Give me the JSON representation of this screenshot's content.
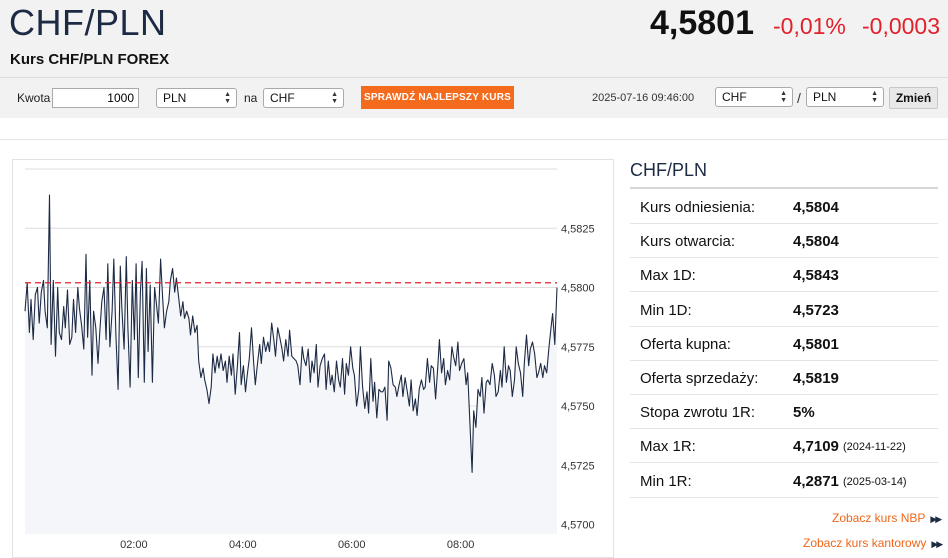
{
  "header": {
    "pair": "CHF/PLN",
    "subtitle": "Kurs CHF/PLN FOREX",
    "price": "4,5801",
    "change_pct": "-0,01%",
    "change_abs": "-0,0003",
    "colors": {
      "negative": "#e2202c",
      "title": "#1d2a44",
      "accent": "#f56b1e"
    }
  },
  "converter": {
    "amount_label": "Kwota",
    "amount_value": "1000",
    "from_currency": "PLN",
    "to_label": "na",
    "to_currency": "CHF",
    "best_rate_button": "SPRAWDŹ NAJLEPSZY KURS"
  },
  "pair_picker": {
    "datetime": "2025-07-16 09:46:00",
    "base": "CHF",
    "separator": "/",
    "quote": "PLN",
    "change_button": "Zmień"
  },
  "stats": {
    "title": "CHF/PLN",
    "rows": [
      {
        "label": "Kurs odniesienia:",
        "value": "4,5804",
        "date": ""
      },
      {
        "label": "Kurs otwarcia:",
        "value": "4,5804",
        "date": ""
      },
      {
        "label": "Max 1D:",
        "value": "4,5843",
        "date": ""
      },
      {
        "label": "Min 1D:",
        "value": "4,5723",
        "date": ""
      },
      {
        "label": "Oferta kupna:",
        "value": "4,5801",
        "date": ""
      },
      {
        "label": "Oferta sprzedaży:",
        "value": "4,5819",
        "date": ""
      },
      {
        "label": "Stopa zwrotu 1R:",
        "value": "5%",
        "date": ""
      },
      {
        "label": "Max 1R:",
        "value": "4,7109",
        "date": "(2024-11-22)"
      },
      {
        "label": "Min 1R:",
        "value": "4,2871",
        "date": "(2025-03-14)"
      }
    ]
  },
  "links": {
    "nbp": "Zobacz kurs NBP",
    "kantor": "Zobacz kurs kantorowy",
    "chevron": "▶▶"
  },
  "chart_data": {
    "type": "line",
    "title": "",
    "xlabel": "",
    "ylabel": "",
    "x_tick_labels": [
      "02:00",
      "04:00",
      "06:00",
      "08:00"
    ],
    "x_tick_hours": [
      2,
      4,
      6,
      8
    ],
    "xlim_hours": [
      0,
      9.77
    ],
    "ylim": [
      4.5696,
      4.585
    ],
    "y_ticks": [
      4.57,
      4.5725,
      4.575,
      4.5775,
      4.58,
      4.5825
    ],
    "y_tick_labels": [
      "4,5700",
      "4,5725",
      "4,5750",
      "4,5775",
      "4,5800",
      "4,5825"
    ],
    "reference_line": 4.5802,
    "grid": true,
    "colors": {
      "line": "#1d2a44",
      "fill": "#f4f6f9",
      "reference": "#e2202c",
      "grid": "#dddddd"
    },
    "series": [
      {
        "points": [
          [
            0.0,
            4.579
          ],
          [
            0.04,
            4.5802
          ],
          [
            0.08,
            4.5781
          ],
          [
            0.11,
            4.5795
          ],
          [
            0.15,
            4.5778
          ],
          [
            0.19,
            4.5797
          ],
          [
            0.23,
            4.58
          ],
          [
            0.26,
            4.5785
          ],
          [
            0.3,
            4.5798
          ],
          [
            0.34,
            4.5803
          ],
          [
            0.37,
            4.579
          ],
          [
            0.41,
            4.5783
          ],
          [
            0.45,
            4.5839
          ],
          [
            0.48,
            4.5776
          ],
          [
            0.52,
            4.5803
          ],
          [
            0.56,
            4.5771
          ],
          [
            0.6,
            4.58
          ],
          [
            0.63,
            4.5781
          ],
          [
            0.67,
            4.5778
          ],
          [
            0.71,
            4.5792
          ],
          [
            0.74,
            4.5783
          ],
          [
            0.78,
            4.5799
          ],
          [
            0.82,
            4.5776
          ],
          [
            0.86,
            4.5779
          ],
          [
            0.89,
            4.5795
          ],
          [
            0.93,
            4.5781
          ],
          [
            0.97,
            4.58
          ],
          [
            1.0,
            4.5791
          ],
          [
            1.04,
            4.5784
          ],
          [
            1.08,
            4.5774
          ],
          [
            1.12,
            4.5814
          ],
          [
            1.15,
            4.5779
          ],
          [
            1.19,
            4.5803
          ],
          [
            1.23,
            4.5763
          ],
          [
            1.26,
            4.579
          ],
          [
            1.3,
            4.5783
          ],
          [
            1.34,
            4.5768
          ],
          [
            1.37,
            4.578
          ],
          [
            1.41,
            4.5794
          ],
          [
            1.45,
            4.58
          ],
          [
            1.49,
            4.5778
          ],
          [
            1.52,
            4.581
          ],
          [
            1.56,
            4.5775
          ],
          [
            1.6,
            4.579
          ],
          [
            1.63,
            4.5812
          ],
          [
            1.67,
            4.578
          ],
          [
            1.71,
            4.5757
          ],
          [
            1.75,
            4.5809
          ],
          [
            1.78,
            4.5791
          ],
          [
            1.82,
            4.5774
          ],
          [
            1.86,
            4.5813
          ],
          [
            1.89,
            4.5783
          ],
          [
            1.93,
            4.5758
          ],
          [
            1.97,
            4.5803
          ],
          [
            2.01,
            4.5778
          ],
          [
            2.04,
            4.581
          ],
          [
            2.08,
            4.5762
          ],
          [
            2.12,
            4.5798
          ],
          [
            2.15,
            4.5811
          ],
          [
            2.19,
            4.576
          ],
          [
            2.23,
            4.5808
          ],
          [
            2.26,
            4.5773
          ],
          [
            2.3,
            4.5801
          ],
          [
            2.34,
            4.576
          ],
          [
            2.38,
            4.58
          ],
          [
            2.41,
            4.5794
          ],
          [
            2.45,
            4.5785
          ],
          [
            2.49,
            4.5812
          ],
          [
            2.52,
            4.5799
          ],
          [
            2.56,
            4.5783
          ],
          [
            2.6,
            4.579
          ],
          [
            2.64,
            4.5794
          ],
          [
            2.67,
            4.5803
          ],
          [
            2.71,
            4.5808
          ],
          [
            2.75,
            4.5798
          ],
          [
            2.78,
            4.5804
          ],
          [
            2.82,
            4.5796
          ],
          [
            2.86,
            4.5788
          ],
          [
            2.9,
            4.5794
          ],
          [
            2.93,
            4.5787
          ],
          [
            2.97,
            4.579
          ],
          [
            3.01,
            4.5787
          ],
          [
            3.04,
            4.578
          ],
          [
            3.08,
            4.5788
          ],
          [
            3.12,
            4.5781
          ],
          [
            3.16,
            4.5784
          ],
          [
            3.19,
            4.5769
          ],
          [
            3.23,
            4.5762
          ],
          [
            3.27,
            4.5766
          ],
          [
            3.3,
            4.5761
          ],
          [
            3.34,
            4.5757
          ],
          [
            3.38,
            4.5751
          ],
          [
            3.42,
            4.5758
          ],
          [
            3.45,
            4.5772
          ],
          [
            3.49,
            4.5764
          ],
          [
            3.53,
            4.5771
          ],
          [
            3.56,
            4.5766
          ],
          [
            3.6,
            4.5772
          ],
          [
            3.64,
            4.5765
          ],
          [
            3.68,
            4.5769
          ],
          [
            3.71,
            4.576
          ],
          [
            3.75,
            4.5771
          ],
          [
            3.79,
            4.5763
          ],
          [
            3.82,
            4.5772
          ],
          [
            3.86,
            4.5755
          ],
          [
            3.9,
            4.5767
          ],
          [
            3.94,
            4.5781
          ],
          [
            3.97,
            4.5759
          ],
          [
            4.01,
            4.5767
          ],
          [
            4.05,
            4.5756
          ],
          [
            4.08,
            4.5763
          ],
          [
            4.12,
            4.577
          ],
          [
            4.16,
            4.5783
          ],
          [
            4.2,
            4.5768
          ],
          [
            4.23,
            4.5759
          ],
          [
            4.27,
            4.5768
          ],
          [
            4.31,
            4.5776
          ],
          [
            4.34,
            4.5768
          ],
          [
            4.38,
            4.5779
          ],
          [
            4.42,
            4.5773
          ],
          [
            4.46,
            4.5777
          ],
          [
            4.49,
            4.5773
          ],
          [
            4.53,
            4.5785
          ],
          [
            4.57,
            4.5778
          ],
          [
            4.6,
            4.5771
          ],
          [
            4.64,
            4.5783
          ],
          [
            4.68,
            4.5779
          ],
          [
            4.72,
            4.5774
          ],
          [
            4.75,
            4.5769
          ],
          [
            4.79,
            4.5778
          ],
          [
            4.83,
            4.5771
          ],
          [
            4.86,
            4.5782
          ],
          [
            4.9,
            4.5771
          ],
          [
            4.94,
            4.577
          ],
          [
            4.98,
            4.5769
          ],
          [
            5.01,
            4.5767
          ],
          [
            5.05,
            4.5759
          ],
          [
            5.09,
            4.5775
          ],
          [
            5.12,
            4.577
          ],
          [
            5.16,
            4.5767
          ],
          [
            5.2,
            4.5774
          ],
          [
            5.24,
            4.576
          ],
          [
            5.27,
            4.5769
          ],
          [
            5.31,
            4.5764
          ],
          [
            5.35,
            4.5776
          ],
          [
            5.38,
            4.5758
          ],
          [
            5.42,
            4.5767
          ],
          [
            5.46,
            4.577
          ],
          [
            5.5,
            4.5772
          ],
          [
            5.53,
            4.5757
          ],
          [
            5.57,
            4.5769
          ],
          [
            5.61,
            4.5759
          ],
          [
            5.64,
            4.5763
          ],
          [
            5.68,
            4.5756
          ],
          [
            5.72,
            4.5769
          ],
          [
            5.76,
            4.5761
          ],
          [
            5.79,
            4.5758
          ],
          [
            5.83,
            4.577
          ],
          [
            5.87,
            4.5755
          ],
          [
            5.9,
            4.5768
          ],
          [
            5.94,
            4.5763
          ],
          [
            5.98,
            4.5775
          ],
          [
            6.02,
            4.5766
          ],
          [
            6.05,
            4.5763
          ],
          [
            6.09,
            4.575
          ],
          [
            6.13,
            4.5757
          ],
          [
            6.16,
            4.5775
          ],
          [
            6.2,
            4.5758
          ],
          [
            6.24,
            4.5749
          ],
          [
            6.28,
            4.5756
          ],
          [
            6.31,
            4.5747
          ],
          [
            6.35,
            4.577
          ],
          [
            6.39,
            4.5752
          ],
          [
            6.42,
            4.576
          ],
          [
            6.46,
            4.5745
          ],
          [
            6.5,
            4.5757
          ],
          [
            6.54,
            4.5756
          ],
          [
            6.57,
            4.5756
          ],
          [
            6.61,
            4.5758
          ],
          [
            6.65,
            4.5744
          ],
          [
            6.68,
            4.5769
          ],
          [
            6.72,
            4.5766
          ],
          [
            6.76,
            4.5759
          ],
          [
            6.8,
            4.5758
          ],
          [
            6.83,
            4.5754
          ],
          [
            6.87,
            4.5759
          ],
          [
            6.91,
            4.5763
          ],
          [
            6.94,
            4.5754
          ],
          [
            6.98,
            4.5762
          ],
          [
            7.02,
            4.5756
          ],
          [
            7.06,
            4.575
          ],
          [
            7.09,
            4.5761
          ],
          [
            7.13,
            4.5748
          ],
          [
            7.17,
            4.5753
          ],
          [
            7.2,
            4.5746
          ],
          [
            7.24,
            4.5757
          ],
          [
            7.28,
            4.5761
          ],
          [
            7.32,
            4.5757
          ],
          [
            7.35,
            4.5758
          ],
          [
            7.39,
            4.577
          ],
          [
            7.43,
            4.576
          ],
          [
            7.46,
            4.5767
          ],
          [
            7.5,
            4.5766
          ],
          [
            7.54,
            4.5753
          ],
          [
            7.58,
            4.5766
          ],
          [
            7.61,
            4.5778
          ],
          [
            7.65,
            4.5764
          ],
          [
            7.69,
            4.577
          ],
          [
            7.72,
            4.5759
          ],
          [
            7.76,
            4.5765
          ],
          [
            7.8,
            4.5761
          ],
          [
            7.84,
            4.5775
          ],
          [
            7.87,
            4.5771
          ],
          [
            7.91,
            4.5767
          ],
          [
            7.95,
            4.5777
          ],
          [
            7.98,
            4.5765
          ],
          [
            8.02,
            4.5768
          ],
          [
            8.06,
            4.577
          ],
          [
            8.1,
            4.5759
          ],
          [
            8.13,
            4.5764
          ],
          [
            8.17,
            4.5743
          ],
          [
            8.21,
            4.5722
          ],
          [
            8.24,
            4.5748
          ],
          [
            8.28,
            4.5741
          ],
          [
            8.32,
            4.5757
          ],
          [
            8.36,
            4.5754
          ],
          [
            8.39,
            4.5762
          ],
          [
            8.43,
            4.5747
          ],
          [
            8.47,
            4.576
          ],
          [
            8.5,
            4.5761
          ],
          [
            8.54,
            4.5759
          ],
          [
            8.58,
            4.5768
          ],
          [
            8.62,
            4.5763
          ],
          [
            8.65,
            4.5754
          ],
          [
            8.69,
            4.5756
          ],
          [
            8.73,
            4.5765
          ],
          [
            8.76,
            4.5758
          ],
          [
            8.8,
            4.5775
          ],
          [
            8.84,
            4.576
          ],
          [
            8.88,
            4.5767
          ],
          [
            8.91,
            4.5765
          ],
          [
            8.95,
            4.5754
          ],
          [
            8.99,
            4.5761
          ],
          [
            9.02,
            4.5775
          ],
          [
            9.06,
            4.5768
          ],
          [
            9.1,
            4.5764
          ],
          [
            9.14,
            4.5754
          ],
          [
            9.17,
            4.5768
          ],
          [
            9.21,
            4.578
          ],
          [
            9.25,
            4.5767
          ],
          [
            9.28,
            4.5774
          ],
          [
            9.32,
            4.5777
          ],
          [
            9.36,
            4.5772
          ],
          [
            9.4,
            4.5762
          ],
          [
            9.43,
            4.5764
          ],
          [
            9.47,
            4.5768
          ],
          [
            9.51,
            4.5762
          ],
          [
            9.54,
            4.5767
          ],
          [
            9.58,
            4.5764
          ],
          [
            9.62,
            4.5774
          ],
          [
            9.66,
            4.5783
          ],
          [
            9.69,
            4.5789
          ],
          [
            9.73,
            4.5776
          ],
          [
            9.77,
            4.58
          ]
        ]
      }
    ]
  }
}
